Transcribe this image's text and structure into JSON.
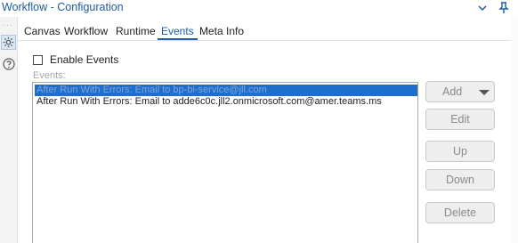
{
  "window": {
    "title": "Workflow - Configuration",
    "chevron_icon": "chevron-down-icon",
    "pin_icon": "pin-icon"
  },
  "left_rail": {
    "items": [
      {
        "icon": "gear-icon",
        "active": true
      },
      {
        "icon": "help-icon",
        "active": false
      }
    ]
  },
  "tabs": [
    {
      "label": "Canvas",
      "active": false
    },
    {
      "label": "Workflow",
      "active": false
    },
    {
      "label": "Runtime",
      "active": false
    },
    {
      "label": "Events",
      "active": true
    },
    {
      "label": "Meta Info",
      "active": false
    }
  ],
  "events_panel": {
    "enable_label": "Enable Events",
    "enable_checked": false,
    "events_label": "Events:",
    "items": [
      {
        "text": "After Run With Errors: Email to bp-bi-service@jll.com",
        "selected": true
      },
      {
        "text": "After Run With Errors: Email to adde6c0c.jll2.onmicrosoft.com@amer.teams.ms",
        "selected": false
      }
    ],
    "buttons": {
      "add": "Add",
      "edit": "Edit",
      "up": "Up",
      "down": "Down",
      "delete": "Delete"
    }
  },
  "colors": {
    "accent": "#1e5aa8",
    "selection": "#1e6fcc",
    "disabled_text": "#8a8a8a"
  }
}
